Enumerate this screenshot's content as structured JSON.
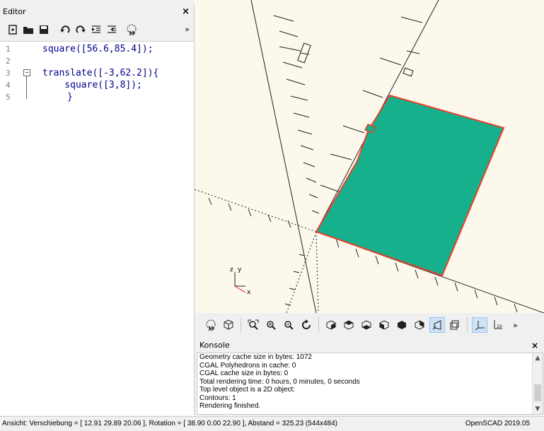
{
  "editor": {
    "title": "Editor",
    "close": "×",
    "more": "»",
    "toolbar": [
      "new-icon",
      "open-icon",
      "save-icon",
      "undo-icon",
      "redo-icon",
      "unindent-icon",
      "indent-icon",
      "render-preview-icon"
    ],
    "lines": [
      {
        "n": "1",
        "code": "square([56.6,85.4]);"
      },
      {
        "n": "2",
        "code": ""
      },
      {
        "n": "3",
        "code": "translate([-3,62.2]){"
      },
      {
        "n": "4",
        "code": "    square([3,8]);"
      },
      {
        "n": "5",
        "code": "}"
      }
    ]
  },
  "viewport": {
    "background": "#fcf8ec",
    "shape_fill": "#16b08c",
    "shape_edge": "#e8402a",
    "axis_label_z": "z",
    "axis_label_y": "y",
    "axis_label_x": "x"
  },
  "view_toolbar": {
    "more": "»",
    "buttons": [
      "preview-icon",
      "render-icon",
      "zoom-all-icon",
      "zoom-in-icon",
      "zoom-out-icon",
      "reset-view-icon",
      "view-right-icon",
      "view-top-icon",
      "view-bottom-icon",
      "view-left-icon",
      "view-front-icon",
      "view-back-icon",
      "perspective-icon",
      "orthogonal-icon",
      "show-axes-icon",
      "show-scale-icon"
    ],
    "scale_label": "10"
  },
  "console": {
    "title": "Konsole",
    "close": "×",
    "lines": [
      "Geometry cache size in bytes: 1072",
      "CGAL Polyhedrons in cache: 0",
      "CGAL cache size in bytes: 0",
      "Total rendering time: 0 hours, 0 minutes, 0 seconds",
      "Top level object is a 2D object:",
      "Contours: 1",
      "Rendering finished."
    ]
  },
  "status": {
    "left": "Ansicht: Verschiebung = [ 12.91 29.89 20.06 ], Rotation = [ 38.90 0.00 22.90 ], Abstand = 325.23 (544x484)",
    "right": "OpenSCAD 2019.05"
  }
}
